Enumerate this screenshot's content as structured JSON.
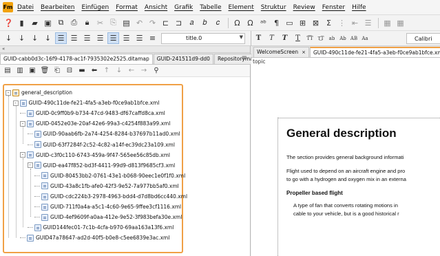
{
  "app": {
    "logo_text": "Fm"
  },
  "menu": [
    "Datei",
    "Bearbeiten",
    "Einfügen",
    "Format",
    "Ansicht",
    "Grafik",
    "Tabelle",
    "Element",
    "Struktur",
    "Review",
    "Fenster",
    "Hilfe"
  ],
  "toolbar2": {
    "style_value": "title.0",
    "font_value": "Calibri"
  },
  "left_panel": {
    "header_text": "«",
    "tabs": [
      "GUID-cabb0d3c-16f9-4178-ac1f-7935302e2525.ditamap",
      "GUID-241511d9-dd0",
      "Repositorymanager"
    ],
    "menu_icon": "hamburger-icon"
  },
  "tree": [
    {
      "label": "general_description",
      "level": 0,
      "icon": "map",
      "expander": "-"
    },
    {
      "label": "GUID-490c11de-fe21-4fa5-a3eb-f0ce9ab1bfce.xml",
      "level": 1,
      "icon": "topic",
      "expander": "-"
    },
    {
      "label": "GUID-0c9ff0b9-b734-47cd-9483-df67caffd8ca.xml",
      "level": 2,
      "icon": "topic",
      "expander": ""
    },
    {
      "label": "GUID-0452e03e-20af-42e6-99a3-c4254f883a99.xml",
      "level": 2,
      "icon": "topic",
      "expander": "-"
    },
    {
      "label": "GUID-90aab6fb-2a74-4254-8284-b37697b11ad0.xml",
      "level": 3,
      "icon": "topic",
      "expander": ""
    },
    {
      "label": "GUID-63f7284f-2c52-4c82-a14f-ec39dc23a109.xml",
      "level": 3,
      "icon": "topic",
      "expander": ""
    },
    {
      "label": "GUID-c3f0c110-6743-459a-9f47-565ee56c85db.xml",
      "level": 2,
      "icon": "topic",
      "expander": "-"
    },
    {
      "label": "GUID-ea47f852-bd3f-4411-99d9-d813f9685cf3.xml",
      "level": 3,
      "icon": "topic",
      "expander": "-"
    },
    {
      "label": "GUID-80453bb2-0761-43e1-b068-90eec1e0f1f0.xml",
      "level": 4,
      "icon": "topic",
      "expander": ""
    },
    {
      "label": "GUID-43a8c1fb-afe0-42f3-9e52-7a977bb5af0.xml",
      "level": 4,
      "icon": "topic",
      "expander": ""
    },
    {
      "label": "GUID-cdc224b3-2978-4963-bdd4-d7d8bd6cc440.xml",
      "level": 4,
      "icon": "topic",
      "expander": ""
    },
    {
      "label": "GUID-711f0a4a-a5c1-4c60-9e65-9ffee3cf1116.xml",
      "level": 4,
      "icon": "topic",
      "expander": ""
    },
    {
      "label": "GUID-4ef9609f-a0aa-412e-9e52-3f983befa30e.xml",
      "level": 4,
      "icon": "topic",
      "expander": ""
    },
    {
      "label": "GUID144fec01-7c1b-4cfa-b970-69aa163a13f6.xml",
      "level": 3,
      "icon": "topic",
      "expander": ""
    },
    {
      "label": "GUID47a78647-ad2d-40f5-b0e8-c5ee6839e3ac.xml",
      "level": 2,
      "icon": "topic",
      "expander": ""
    }
  ],
  "right_panel": {
    "tabs": [
      {
        "label": "WelcomeScreen",
        "close": "×"
      },
      {
        "label": "GUID-490c11de-fe21-4fa5-a3eb-f0ce9ab1bfce.xml",
        "close": "×"
      }
    ],
    "breadcrumb": "topic",
    "doc": {
      "title": "General description",
      "para1": "The section provides general background informati",
      "para2_line1": "Flight used to depend on an aircraft engine and pro",
      "para2_line2": "to go with a hydrogen and oxygen mix in an externa",
      "subheading": "Propeller based flight",
      "para3_line1": "A type of fan that converts rotating motions in",
      "para3_line2": "cable to your vehicle, but is a good historical r"
    }
  }
}
